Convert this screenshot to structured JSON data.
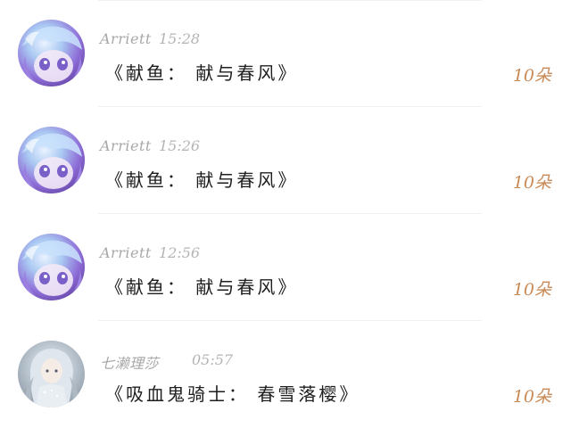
{
  "gift_list": {
    "items": [
      {
        "user": "Arriett",
        "time": "15:28",
        "gift": "《献鱼： 献与春风》",
        "count": "10朵",
        "avatar": "anime-girl-avatar"
      },
      {
        "user": "Arriett",
        "time": "15:26",
        "gift": "《献鱼： 献与春风》",
        "count": "10朵",
        "avatar": "anime-girl-avatar"
      },
      {
        "user": "Arriett",
        "time": "12:56",
        "gift": "《献鱼： 献与春风》",
        "count": "10朵",
        "avatar": "anime-girl-avatar"
      },
      {
        "user": "七濑理莎",
        "time": "05:57",
        "gift": "《吸血鬼骑士： 春雪落樱》",
        "count": "10朵",
        "avatar": "silver-hair-girl-avatar"
      }
    ]
  },
  "colors": {
    "username": "#a8a8a8",
    "timestamp": "#b4b4b4",
    "title": "#1e1e1e",
    "count_accent": "#c98a55",
    "divider": "#f0f0f0"
  }
}
